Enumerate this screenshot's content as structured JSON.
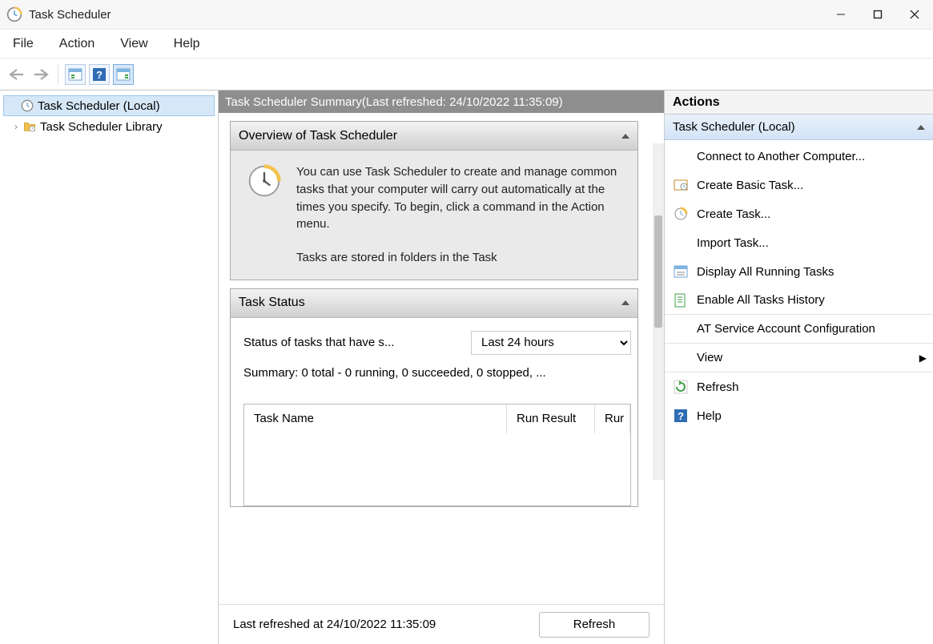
{
  "titlebar": {
    "title": "Task Scheduler"
  },
  "menu": {
    "items": [
      "File",
      "Action",
      "View",
      "Help"
    ]
  },
  "tree": {
    "root": "Task Scheduler (Local)",
    "child": "Task Scheduler Library"
  },
  "summary": {
    "bar_prefix": "Task Scheduler Summary ",
    "bar_suffix": "(Last refreshed: 24/10/2022 11:35:09)"
  },
  "overview": {
    "title": "Overview of Task Scheduler",
    "text": "You can use Task Scheduler to create and manage common tasks that your computer will carry out automatically at the times you specify. To begin, click a command in the Action menu.",
    "more": "Tasks are stored in folders in the Task"
  },
  "taskstatus": {
    "title": "Task Status",
    "label": "Status of tasks that have s...",
    "period_selected": "Last 24 hours",
    "summary_line": "Summary: 0 total - 0 running, 0 succeeded, 0 stopped, ...",
    "columns": {
      "a": "Task Name",
      "b": "Run Result",
      "c": "Rur"
    }
  },
  "footer": {
    "last_refreshed": "Last refreshed at 24/10/2022 11:35:09",
    "refresh": "Refresh"
  },
  "actions": {
    "header": "Actions",
    "group": "Task Scheduler (Local)",
    "items": [
      {
        "label": "Connect to Another Computer..."
      },
      {
        "label": "Create Basic Task..."
      },
      {
        "label": "Create Task..."
      },
      {
        "label": "Import Task..."
      },
      {
        "label": "Display All Running Tasks"
      },
      {
        "label": "Enable All Tasks History"
      },
      {
        "label": "AT Service Account Configuration"
      },
      {
        "label": "View",
        "submenu": true
      },
      {
        "label": "Refresh"
      },
      {
        "label": "Help"
      }
    ]
  }
}
